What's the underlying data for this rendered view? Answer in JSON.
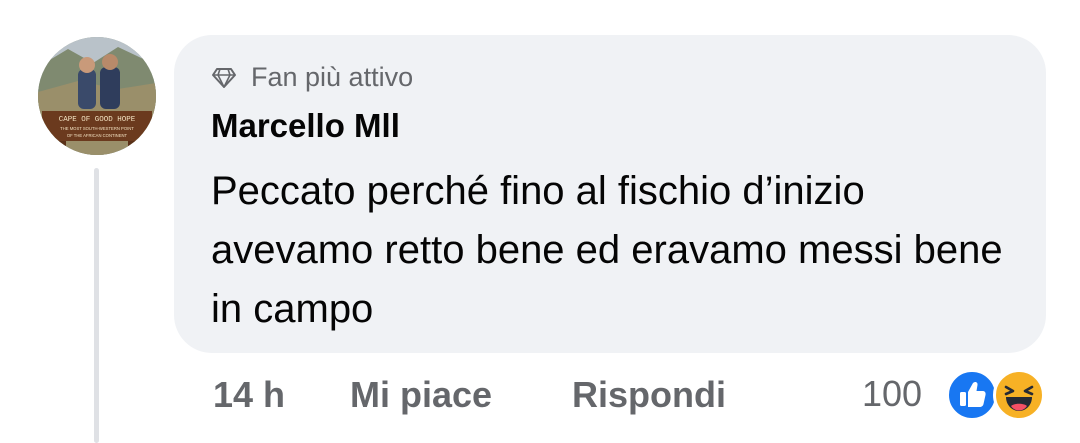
{
  "comment": {
    "badge": "Fan più attivo",
    "author": "Marcello Mll",
    "text": "Peccato perché fino al fischio d’inizio avevamo retto bene ed eravamo messi bene in campo",
    "avatar_sign": {
      "line1": "CAPE OF GOOD HOPE",
      "line2": "THE MOST SOUTH-WESTERN POINT",
      "line3": "OF THE AFRICAN CONTINENT"
    }
  },
  "actions": {
    "time": "14 h",
    "like": "Mi piace",
    "reply": "Rispondi"
  },
  "reactions": {
    "count": "100",
    "types": [
      "like-icon",
      "haha-icon"
    ],
    "colors": {
      "like": "#1877f2",
      "haha": "#f7b125"
    }
  }
}
